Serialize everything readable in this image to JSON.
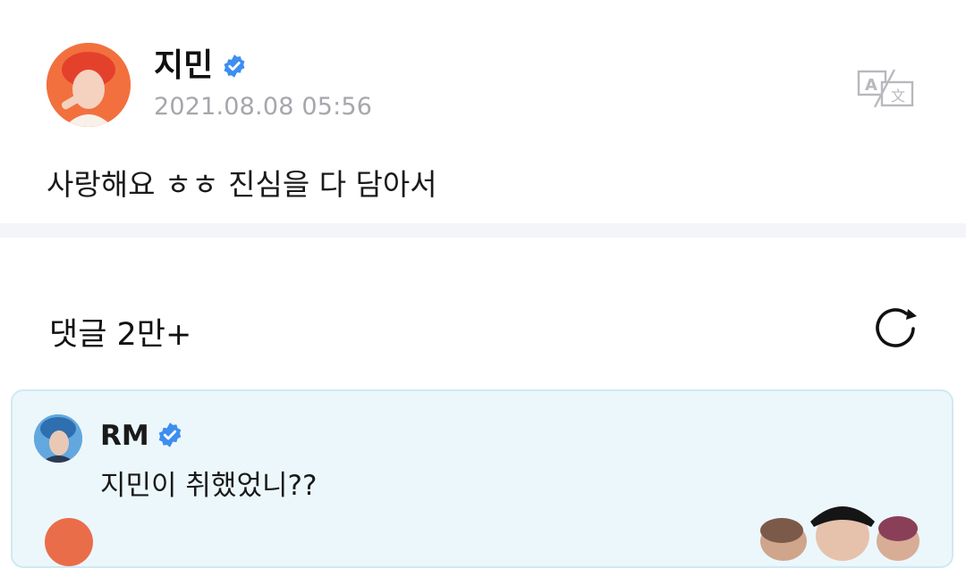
{
  "post": {
    "author": "지민",
    "timestamp": "2021.08.08 05:56",
    "text": "사랑해요 ㅎㅎ 진심을 다 담아서",
    "verified_icon": "verified-badge-icon",
    "translate_icon": "translate-icon"
  },
  "comments": {
    "title": "댓글 2만+",
    "refresh_icon": "refresh-icon",
    "pinned": {
      "author": "RM",
      "text": "지민이 취했었니??"
    }
  },
  "colors": {
    "verified": "#3d8ef0",
    "card_bg": "#ecf7fb",
    "card_border": "#cfe9f2",
    "timestamp": "#a6a6ad",
    "divider": "#f4f5f8"
  }
}
